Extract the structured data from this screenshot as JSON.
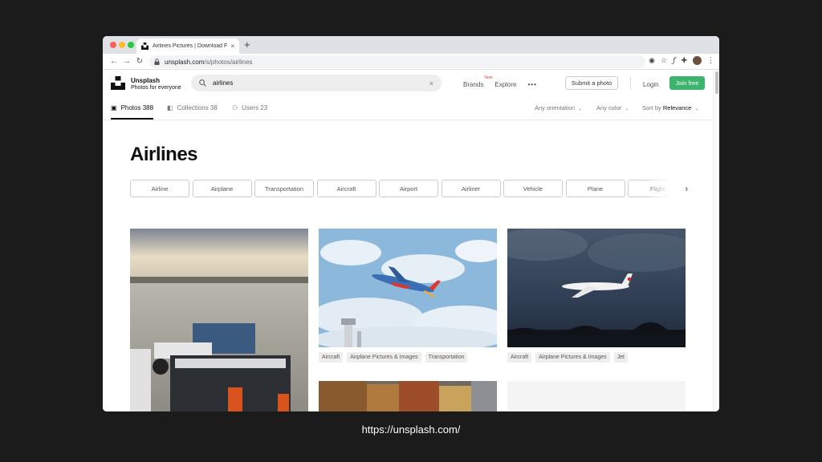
{
  "browser": {
    "tab_title": "Airlines Pictures | Download F",
    "tab_close": "×",
    "new_tab": "+",
    "url_host": "unsplash.com",
    "url_path": "/s/photos/airlines",
    "back": "←",
    "forward": "→",
    "reload": "↻"
  },
  "header": {
    "brand_name": "Unsplash",
    "brand_tagline": "Photos for everyone",
    "search_value": "airlines",
    "search_clear": "×",
    "nav": {
      "brands": "Brands",
      "new_badge": "New",
      "explore": "Explore",
      "more": "•••"
    },
    "submit": "Submit a photo",
    "login": "Login",
    "join": "Join free"
  },
  "subnav": {
    "photos": "Photos 388",
    "collections": "Collections 38",
    "users": "Users 23",
    "orientation": "Any orientation",
    "color": "Any color",
    "sort_label": "Sort by",
    "sort_value": "Relevance"
  },
  "page_title": "Airlines",
  "chips": [
    "Airline",
    "Airplane",
    "Transportation",
    "Aircraft",
    "Airport",
    "Airliner",
    "Vehicle",
    "Plane",
    "Flight"
  ],
  "photo_tags": {
    "col2": [
      "Aircraft",
      "Airplane Pictures & Images",
      "Transportation"
    ],
    "col3": [
      "Aircraft",
      "Airplane Pictures & Images",
      "Jet"
    ]
  },
  "caption": "https://unsplash.com/",
  "colors": {
    "accent_green": "#3cb46e",
    "new_badge": "#e2483b"
  }
}
